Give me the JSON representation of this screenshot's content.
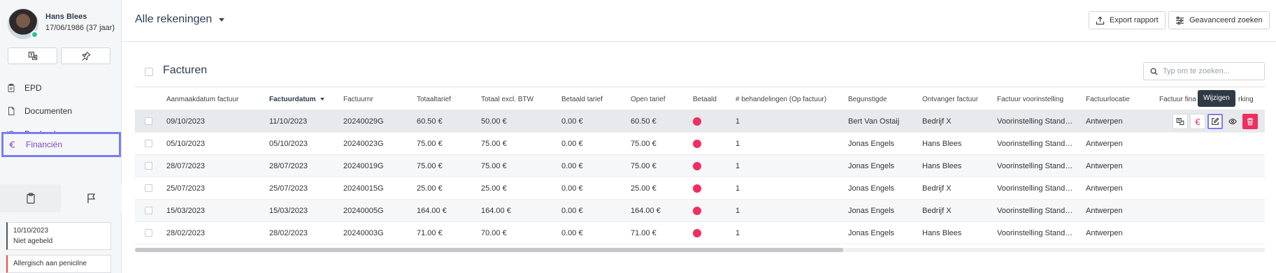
{
  "patient": {
    "name": "Hans Blees",
    "dob": "17/06/1986 (37 jaar)"
  },
  "sidebar": {
    "nav": [
      {
        "label": "EPD",
        "icon": "clipboard-icon"
      },
      {
        "label": "Documenten",
        "icon": "document-icon"
      },
      {
        "label": "Dagboek",
        "icon": "history-icon"
      },
      {
        "label": "Financiën",
        "icon": "euro-icon",
        "active": true
      }
    ],
    "notes": [
      {
        "date": "10/10/2023",
        "text": "Niet agebeld"
      },
      {
        "text": "Allergisch aan penicilne"
      }
    ]
  },
  "topbar": {
    "title": "Alle rekeningen",
    "export_label": "Export rapport",
    "advanced_label": "Geavanceerd zoeken"
  },
  "panel": {
    "title": "Facturen",
    "search_placeholder": "Typ om te zoeken..."
  },
  "table": {
    "columns": [
      "Aanmaakdatum factuur",
      "Factuurdatum",
      "Factuurnr",
      "Totaaltarief",
      "Totaal excl. BTW",
      "Betaald tarief",
      "Open tarief",
      "Betaald",
      "# behandelingen (Op factuur)",
      "Begunstigde",
      "Ontvanger factuur",
      "Factuur voorinstelling",
      "Factuurlocatie",
      "Factuur fina",
      "rking"
    ],
    "rows": [
      {
        "created": "09/10/2023",
        "date": "11/10/2023",
        "nr": "20240029G",
        "total": "60.50 €",
        "excl": "50.00 €",
        "paid": "0.00 €",
        "open": "60.50 €",
        "count": "1",
        "beneficiary": "Bert Van Ostaij",
        "recipient": "Bedrijf X",
        "preset": "Voorinstelling Standaard",
        "location": "Antwerpen"
      },
      {
        "created": "05/10/2023",
        "date": "05/10/2023",
        "nr": "20240023G",
        "total": "75.00 €",
        "excl": "75.00 €",
        "paid": "0.00 €",
        "open": "75.00 €",
        "count": "1",
        "beneficiary": "Jonas Engels",
        "recipient": "Hans Blees",
        "preset": "Voorinstelling Standaard",
        "location": "Antwerpen"
      },
      {
        "created": "28/07/2023",
        "date": "28/07/2023",
        "nr": "20240019G",
        "total": "75.00 €",
        "excl": "75.00 €",
        "paid": "0.00 €",
        "open": "75.00 €",
        "count": "1",
        "beneficiary": "Jonas Engels",
        "recipient": "Hans Blees",
        "preset": "Voorinstelling Standaard",
        "location": "Antwerpen"
      },
      {
        "created": "25/07/2023",
        "date": "25/07/2023",
        "nr": "20240015G",
        "total": "25.00 €",
        "excl": "25.00 €",
        "paid": "0.00 €",
        "open": "25.00 €",
        "count": "1",
        "beneficiary": "Jonas Engels",
        "recipient": "Bedrijf X",
        "preset": "Voorinstelling Standaard",
        "location": "Antwerpen"
      },
      {
        "created": "15/03/2023",
        "date": "15/03/2023",
        "nr": "20240005G",
        "total": "164.00 €",
        "excl": "164.00 €",
        "paid": "0.00 €",
        "open": "164.00 €",
        "count": "1",
        "beneficiary": "Jonas Engels",
        "recipient": "Bedrijf X",
        "preset": "Voorinstelling Standaard",
        "location": "Antwerpen"
      },
      {
        "created": "28/02/2023",
        "date": "28/02/2023",
        "nr": "20240003G",
        "total": "71.00 €",
        "excl": "70.00 €",
        "paid": "0.00 €",
        "open": "71.00 €",
        "count": "1",
        "beneficiary": "Jonas Engels",
        "recipient": "Hans Blees",
        "preset": "Voorinstelling Standaard",
        "location": "Antwerpen"
      }
    ],
    "row_actions": {
      "tooltip": "Wijzigen",
      "euro_glyph": "€"
    }
  },
  "colors": {
    "accent": "#7b7cf3",
    "active_nav_text": "#7b4bd6",
    "paid_dot": "#ef2e61",
    "danger": "#ef2e61"
  }
}
